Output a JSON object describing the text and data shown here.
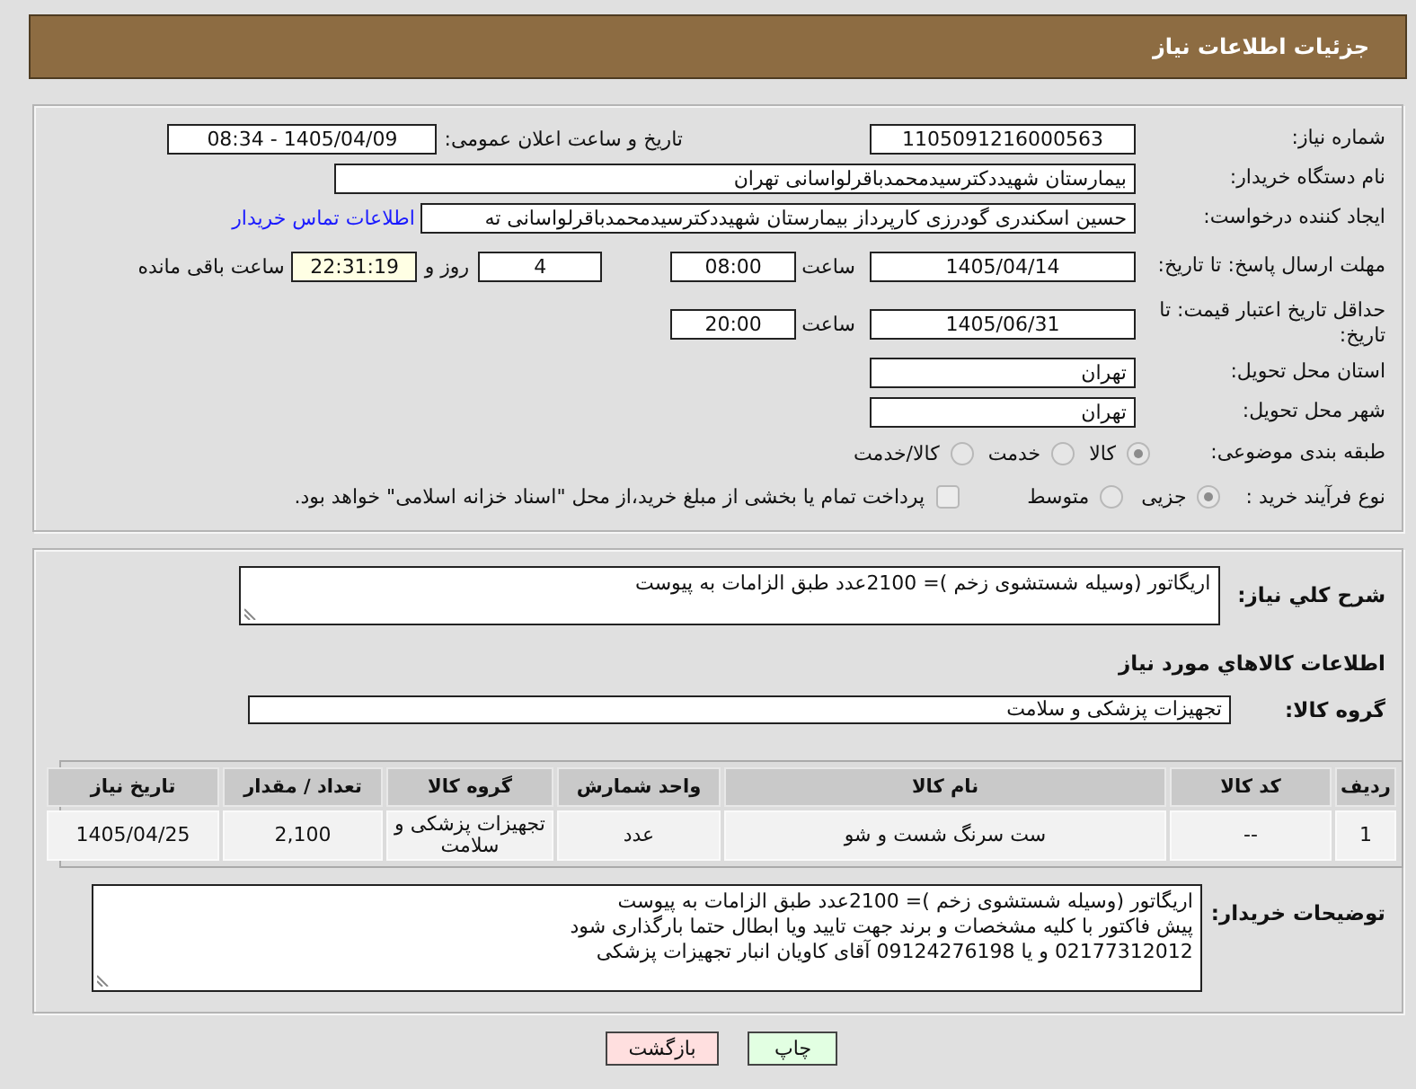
{
  "header": {
    "title": "جزئیات اطلاعات نیاز"
  },
  "details": {
    "need_number": {
      "label": "شماره نیاز:",
      "value": "1105091216000563"
    },
    "announcement": {
      "label": "تاریخ و ساعت اعلان عمومی:",
      "value": "1405/04/09 - 08:34"
    },
    "buyer_organization": {
      "label": "نام دستگاه خریدار:",
      "value": "بیمارستان شهیددکترسیدمحمدباقرلواسانی تهران"
    },
    "requester": {
      "label": "ایجاد کننده درخواست:",
      "value": "حسین اسکندری گودرزی کارپرداز بیمارستان شهیددکترسیدمحمدباقرلواسانی ته",
      "contact_link": "اطلاعات تماس خریدار"
    },
    "reply_deadline": {
      "label": "مهلت ارسال پاسخ: تا تاریخ:",
      "date": "1405/04/14",
      "time_label": "ساعت",
      "time": "08:00",
      "days": "4",
      "days_label": "روز و",
      "remaining": "22:31:19",
      "remaining_label": "ساعت باقی مانده"
    },
    "price_validity": {
      "label": "حداقل تاریخ اعتبار قیمت: تا تاریخ:",
      "date": "1405/06/31",
      "time_label": "ساعت",
      "time": "20:00"
    },
    "delivery_province": {
      "label": "استان محل تحویل:",
      "value": "تهران"
    },
    "delivery_city": {
      "label": "شهر محل تحویل:",
      "value": "تهران"
    },
    "category": {
      "label": "طبقه بندی موضوعی:",
      "options": [
        {
          "label": "کالا",
          "selected": true
        },
        {
          "label": "خدمت",
          "selected": false
        },
        {
          "label": "کالا/خدمت",
          "selected": false
        }
      ]
    },
    "purchase_process": {
      "label": "نوع فرآیند خرید :",
      "options": [
        {
          "label": "جزیی",
          "selected": true
        },
        {
          "label": "متوسط",
          "selected": false
        }
      ],
      "treasury_payment": {
        "label": "پرداخت تمام یا بخشی از مبلغ خرید،از محل \"اسناد خزانه اسلامی\" خواهد بود.",
        "checked": false
      }
    }
  },
  "need": {
    "description": {
      "label": "شرح کلي نياز:",
      "value": "اریگاتور (وسیله شستشوی زخم )= 2100عدد طبق الزامات به پیوست"
    },
    "goods_title": "اطلاعات کالاهاي مورد نياز",
    "goods_group": {
      "label": "گروه کالا:",
      "value": "تجهیزات پزشکی و سلامت"
    },
    "table": {
      "columns": [
        "ردیف",
        "کد کالا",
        "نام کالا",
        "واحد شمارش",
        "گروه کالا",
        "تعداد / مقدار",
        "تاریخ نیاز"
      ],
      "rows": [
        [
          "1",
          "--",
          "ست سرنگ شست و شو",
          "عدد",
          "تجهیزات پزشکی و سلامت",
          "2,100",
          "1405/04/25"
        ]
      ]
    },
    "buyer_notes": {
      "label": "توضیحات خریدار:",
      "value": "اریگاتور (وسیله شستشوی زخم )= 2100عدد طبق الزامات به پیوست\nپیش فاکتور با کلیه مشخصات و برند جهت تایید ویا ابطال حتما بارگذاری شود\n02177312012 و یا 09124276198 آقای کاویان انبار تجهیزات پزشکی"
    }
  },
  "buttons": [
    {
      "label": "چاپ",
      "kind": "print"
    },
    {
      "label": "بازگشت",
      "kind": "back"
    }
  ]
}
